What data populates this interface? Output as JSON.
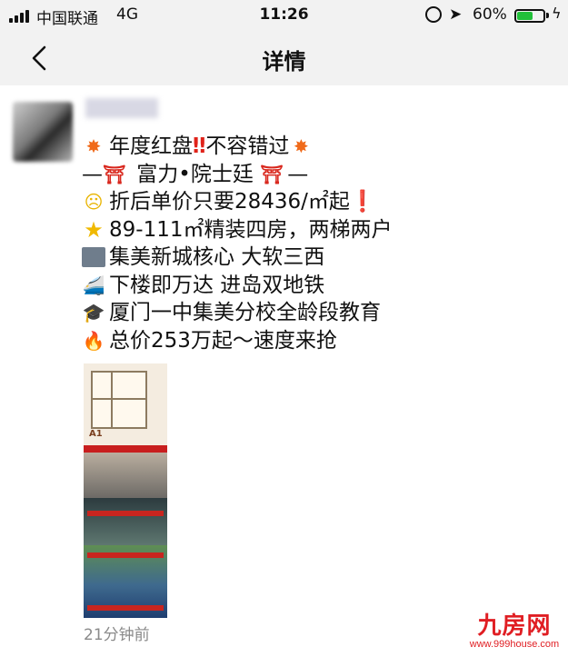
{
  "status": {
    "carrier": "中国联通",
    "network": "4G",
    "time": "11:26",
    "battery_pct": "60%",
    "battery_level": 0.6,
    "battery_color": "#22c03a"
  },
  "nav": {
    "back_icon": "chevron-left-icon",
    "title": "详情"
  },
  "post": {
    "lines": [
      {
        "icon": "collision-icon",
        "glyph": "✸",
        "text": "年度红盘",
        "bang": "‼",
        "text2": "不容错过",
        "tail_glyph": "✸"
      },
      {
        "prefix": "—",
        "icon": "torii-gate-icon",
        "glyph": "⛩",
        "text": " 富力•院士廷 ",
        "tail_glyph": "⛩",
        "suffix": "—"
      },
      {
        "icon": "screaming-face-icon",
        "glyph": "☹",
        "text": "折后单价只要28436/㎡起",
        "bang": "❗"
      },
      {
        "icon": "glowing-star-icon",
        "glyph": "★",
        "text": "89-111㎡精装四房，两梯两户"
      },
      {
        "icon": "office-building-icon",
        "glyph": "",
        "text": "集美新城核心 大软三西"
      },
      {
        "icon": "high-speed-train-icon",
        "glyph": "🚄",
        "text": "下楼即万达 进岛双地铁"
      },
      {
        "icon": "graduation-cap-icon",
        "glyph": "🎓",
        "text": "厦门一中集美分校全龄段教育"
      },
      {
        "icon": "fire-icon",
        "glyph": "🔥",
        "text": "总价253万起～速度来抢"
      }
    ],
    "time_ago": "21分钟前"
  },
  "watermark": {
    "logo": "九房网",
    "url": "www.999house.com"
  }
}
